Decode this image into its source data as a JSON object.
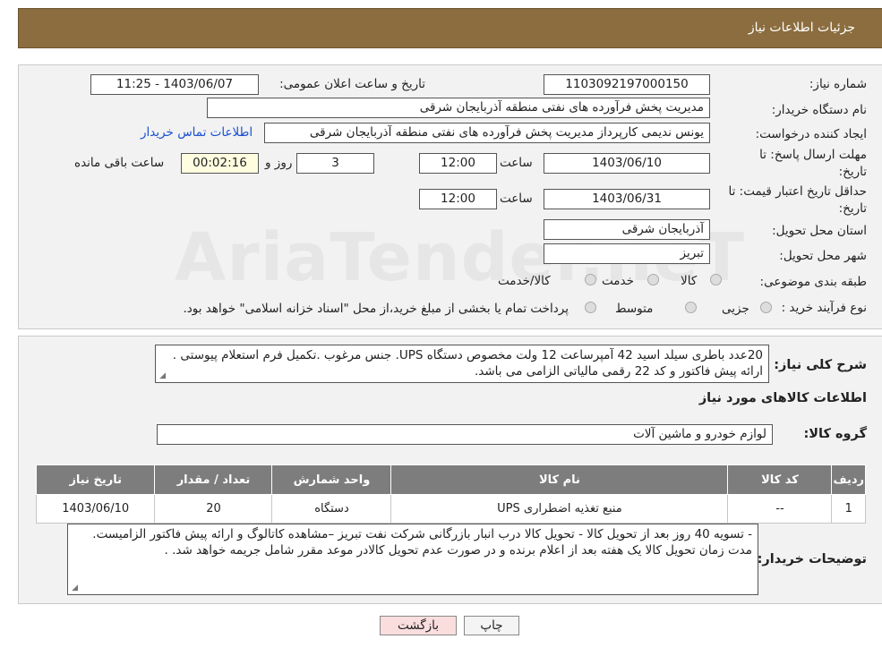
{
  "header": {
    "title": "جزئیات اطلاعات نیاز"
  },
  "watermark": "AriaTender.neT",
  "form": {
    "need_number_label": "شماره نیاز:",
    "need_number": "1103092197000150",
    "announce_label": "تاریخ و ساعت اعلان عمومی:",
    "announce_value": "1403/06/07 - 11:25",
    "buyer_label": "نام دستگاه خریدار:",
    "buyer_value": "مدیریت پخش فرآورده های نفتی منطقه آذربایجان شرقی",
    "creator_label": "ایجاد کننده درخواست:",
    "creator_value": "یونس ندیمی کارپرداز مدیریت پخش فرآورده های نفتی منطقه آذربایجان شرقی",
    "contact_link": "اطلاعات تماس خریدار",
    "deadline_label_1": "مهلت ارسال پاسخ: تا",
    "deadline_label_2": "تاریخ:",
    "deadline_date": "1403/06/10",
    "time_word": "ساعت",
    "deadline_time": "12:00",
    "days_count": "3",
    "days_word": "روز و",
    "remaining_time": "00:02:16",
    "remaining_word": "ساعت باقی مانده",
    "validity_label_1": "حداقل تاریخ اعتبار قیمت: تا",
    "validity_label_2": "تاریخ:",
    "validity_date": "1403/06/31",
    "validity_time": "12:00",
    "province_label": "استان محل تحویل:",
    "province_value": "آذربایجان شرقی",
    "city_label": "شهر محل تحویل:",
    "city_value": "تبریز",
    "category_label": "طبقه بندی موضوعی:",
    "category_options": [
      "کالا",
      "خدمت",
      "کالا/خدمت"
    ],
    "process_label": "نوع فرآیند خرید :",
    "process_options": [
      "جزیی",
      "متوسط"
    ],
    "process_note": "پرداخت تمام یا بخشی از مبلغ خرید،از محل \"اسناد خزانه اسلامی\" خواهد بود."
  },
  "description": {
    "label": "شرح کلی نیاز:",
    "text": "20عدد باطری سیلد اسید 42 آمپرساعت 12 ولت مخصوص دستگاه UPS. جنس مرغوب .تکمیل فرم استعلام پیوستی . ارائه پیش فاکتور و کد 22 رقمی مالیاتی الزامی می باشد."
  },
  "goods_section": {
    "title": "اطلاعات کالاهای مورد نیاز",
    "group_label": "گروه کالا:",
    "group_value": "لوازم خودرو و ماشین آلات"
  },
  "table": {
    "headers": [
      "ردیف",
      "کد کالا",
      "نام کالا",
      "واحد شمارش",
      "تعداد / مقدار",
      "تاریخ نیاز"
    ],
    "rows": [
      [
        "1",
        "--",
        "منبع تغذیه اضطراری UPS",
        "دستگاه",
        "20",
        "1403/06/10"
      ]
    ]
  },
  "buyer_notes": {
    "label": "توضیحات خریدار:",
    "text": "- تسویه 40 روز بعد از تحویل کالا - تحویل کالا درب انبار بازرگانی شرکت نفت تبریز –مشاهده کاتالوگ و ارائه پیش فاکتور الزامیست. مدت زمان تحویل کالا یک هفته بعد از اعلام برنده و در صورت عدم تحویل کالادر موعد مقرر شامل جریمه خواهد شد. ."
  },
  "buttons": {
    "print": "چاپ",
    "back": "بازگشت"
  },
  "colors": {
    "header_bg": "#8b6d3f",
    "table_header_bg": "#7d7d7d",
    "back_button_bg": "#fadede"
  }
}
